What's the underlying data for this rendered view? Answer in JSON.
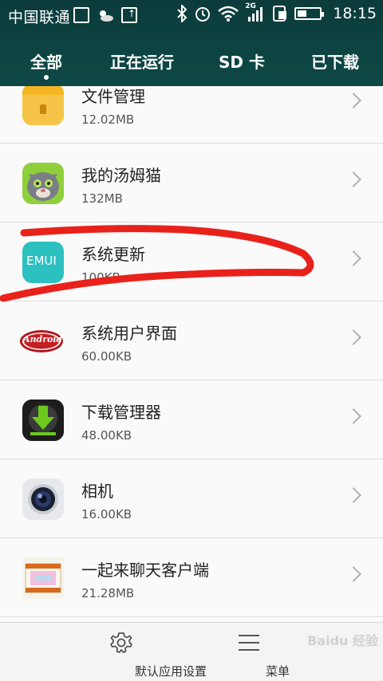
{
  "status_bar": {
    "carrier": "中国联通",
    "network": "2G",
    "time": "18:15"
  },
  "tabs": [
    {
      "label": "全部",
      "active": true
    },
    {
      "label": "正在运行",
      "active": false
    },
    {
      "label": "SD 卡",
      "active": false
    },
    {
      "label": "已下载",
      "active": false
    }
  ],
  "apps": [
    {
      "name": "文件管理",
      "size": "12.02MB",
      "icon": "folder-icon"
    },
    {
      "name": "我的汤姆猫",
      "size": "132MB",
      "icon": "tom-cat-icon"
    },
    {
      "name": "系统更新",
      "size": "100KB",
      "icon": "emui-icon",
      "icon_text": "EMUI"
    },
    {
      "name": "系统用户界面",
      "size": "60.00KB",
      "icon": "android-logo-icon",
      "icon_text": "Android"
    },
    {
      "name": "下载管理器",
      "size": "48.00KB",
      "icon": "download-icon"
    },
    {
      "name": "相机",
      "size": "16.00KB",
      "icon": "camera-icon"
    },
    {
      "name": "一起来聊天客户端",
      "size": "21.28MB",
      "icon": "chat-client-icon"
    }
  ],
  "bottom_bar": {
    "settings_label": "默认应用设置",
    "menu_label": "菜单"
  },
  "watermark": "Baidu 经验",
  "colors": {
    "header": "#0d4442",
    "annotation": "#e8221b",
    "emui": "#2cc0c0"
  }
}
